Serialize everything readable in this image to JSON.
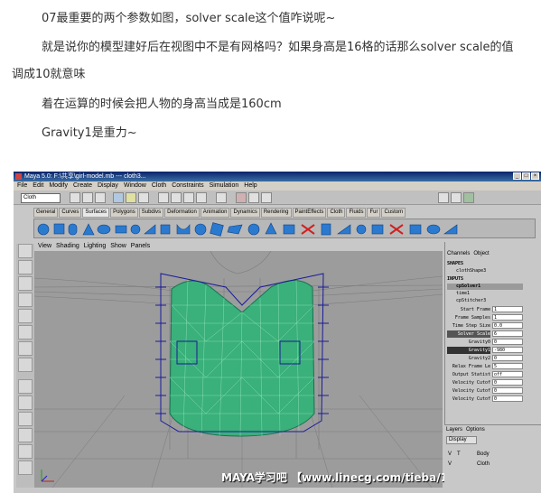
{
  "post": {
    "p1": "07最重要的两个参数如图，solver scale这个值咋说呢~",
    "p2a": "就是说你的模型建好后在视图中不是有网格吗？如果身高是16格的话那么solver scale的值",
    "p2b": "调成10就意味",
    "p3": "着在运算的时候会把人物的身高当成是160cm",
    "p4": "Gravity1是重力~"
  },
  "maya": {
    "title": "Maya 5.0: F:\\共享\\girl-model.mb  ---  cloth3...",
    "menus": [
      "File",
      "Edit",
      "Modify",
      "Create",
      "Display",
      "Window",
      "Cloth",
      "Constraints",
      "Simulation",
      "Help"
    ],
    "mode": "Cloth",
    "shelf_tabs": [
      "General",
      "Curves",
      "Surfaces",
      "Polygons",
      "Subdivs",
      "Deformation",
      "Animation",
      "Dynamics",
      "Rendering",
      "PaintEffects",
      "Cloth",
      "Fluids",
      "Fur",
      "Custom"
    ],
    "active_shelf": "Surfaces",
    "panel_menus": [
      "View",
      "Shading",
      "Lighting",
      "Show",
      "Panels"
    ],
    "channels_tabs": [
      "Channels",
      "Object"
    ],
    "shapes_label": "SHAPES",
    "shape_name": "clothShape3",
    "inputs_label": "INPUTS",
    "inputs": [
      "cpSolver1",
      "time1",
      "cpStitcher3"
    ],
    "attributes": [
      {
        "name": "Start Frame",
        "value": "1"
      },
      {
        "name": "Frame Samples",
        "value": "1"
      },
      {
        "name": "Time Step Size",
        "value": "0.0"
      },
      {
        "name": "Solver Scale",
        "value": "6"
      },
      {
        "name": "Gravity0",
        "value": "0"
      },
      {
        "name": "Gravity1",
        "value": "-980"
      },
      {
        "name": "Gravity2",
        "value": "0"
      },
      {
        "name": "Relax Frame Le",
        "value": "5"
      },
      {
        "name": "Output Statist",
        "value": "off"
      },
      {
        "name": "Velocity Cutof",
        "value": "0"
      },
      {
        "name": "Velocity Cutof",
        "value": "0"
      },
      {
        "name": "Velocity Cutof",
        "value": "0"
      }
    ],
    "layers_tabs": [
      "Layers",
      "Options"
    ],
    "layer_display": "Display",
    "layers": [
      {
        "v": "V",
        "t": "T",
        "name": "Body"
      },
      {
        "v": "V",
        "t": "",
        "name": "Cloth"
      }
    ],
    "watermark": "MAYA学习吧 【www.linecg.com/tieba/1800】"
  }
}
